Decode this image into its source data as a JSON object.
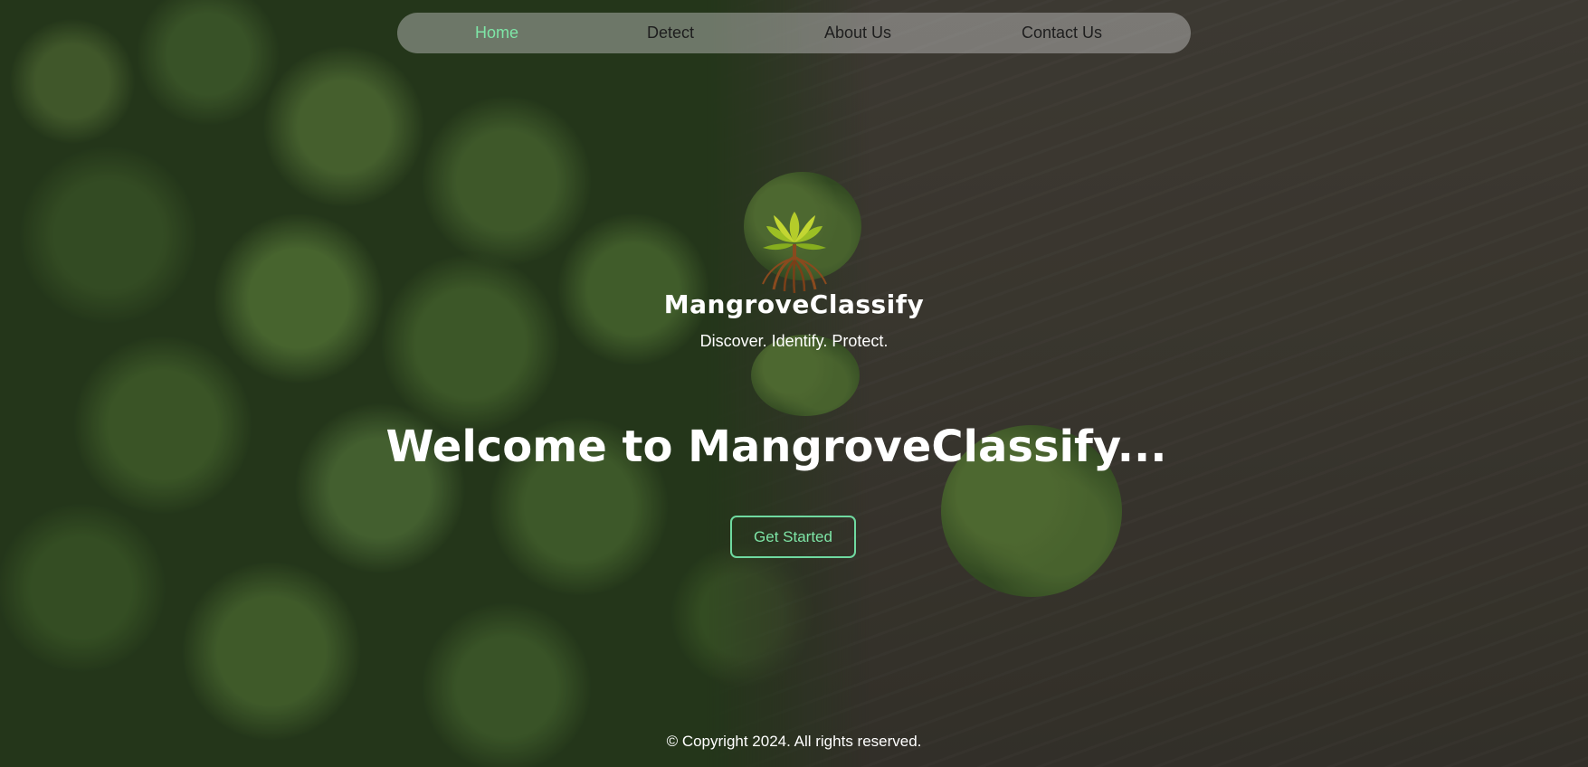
{
  "nav": {
    "items": [
      {
        "label": "Home",
        "active": true
      },
      {
        "label": "Detect",
        "active": false
      },
      {
        "label": "About Us",
        "active": false
      },
      {
        "label": "Contact Us",
        "active": false
      }
    ]
  },
  "brand": {
    "name": "MangroveClassify",
    "tagline": "Discover. Identify. Protect.",
    "logo_icon": "mangrove-tree-icon"
  },
  "hero": {
    "heading": "Welcome to MangroveClassify...",
    "cta_label": "Get Started"
  },
  "footer": {
    "copyright": "© Copyright 2024. All rights reserved."
  },
  "colors": {
    "accent": "#7ee6a7",
    "text": "#ffffff",
    "nav_text": "#1e1e1e"
  }
}
